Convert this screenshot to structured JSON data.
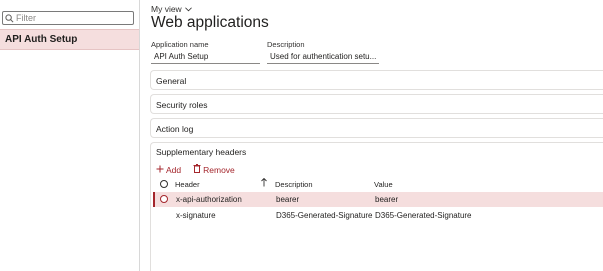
{
  "left_pane": {
    "filter_placeholder": "Filter",
    "items": [
      {
        "label": "API Auth Setup",
        "selected": true
      }
    ]
  },
  "header": {
    "my_view": "My view",
    "title": "Web applications"
  },
  "fields": {
    "application_name_label": "Application name",
    "application_name_value": "API Auth Setup",
    "description_label": "Description",
    "description_value": "Used for authentication setu..."
  },
  "sections": {
    "general": "General",
    "security_roles": "Security roles",
    "action_log": "Action log",
    "supplementary_headers": "Supplementary headers"
  },
  "toolbar": {
    "add_label": "Add",
    "remove_label": "Remove"
  },
  "grid": {
    "columns": {
      "header": "Header",
      "description": "Description",
      "value": "Value"
    },
    "rows": [
      {
        "header": "x-api-authorization",
        "description": "bearer",
        "value": "bearer",
        "selected": true
      },
      {
        "header": "x-signature",
        "description": "D365-Generated-Signature",
        "value": "D365-Generated-Signature",
        "selected": false
      }
    ]
  },
  "colors": {
    "accent": "#a4262c",
    "selected_bg": "#f5dede"
  }
}
